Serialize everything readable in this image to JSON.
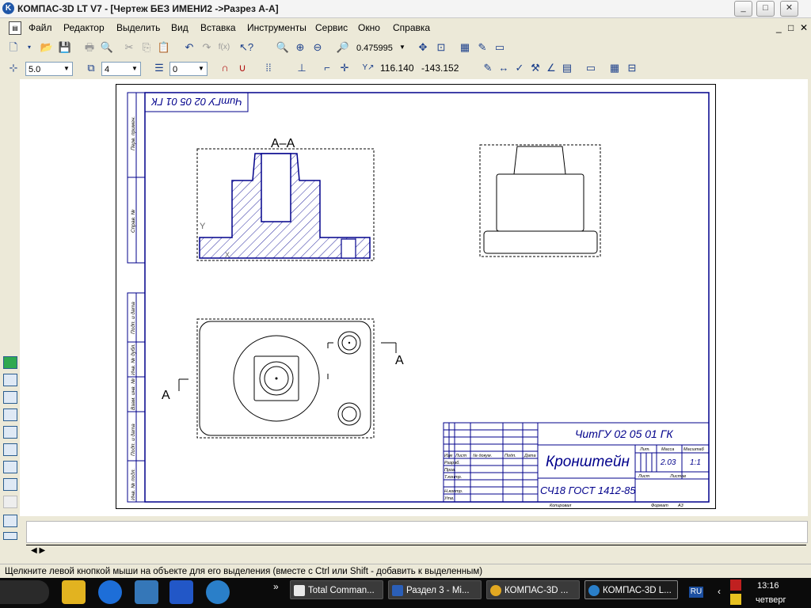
{
  "window": {
    "title": "КОМПАС-3D LT V7 - [Чертеж БЕЗ ИМЕНИ2 ->Разрез А-А]",
    "app_icon": "kompas-icon",
    "buttons": {
      "minimize": "_",
      "maximize": "□",
      "close": "✕"
    }
  },
  "menu": {
    "items": [
      "Файл",
      "Редактор",
      "Выделить",
      "Вид",
      "Вставка",
      "Инструменты",
      "Сервис",
      "Окно",
      "Справка"
    ],
    "mdi_buttons": [
      "_",
      "□",
      "✕"
    ]
  },
  "toolbar1": {
    "zoom_value": "0.475995"
  },
  "toolbar2": {
    "step_value": "5.0",
    "layer_value": "4",
    "style_value": "0",
    "coord_x": "116.140",
    "coord_y": "-143.152"
  },
  "drawing": {
    "section_label": "А–А",
    "cut_label_left": "А",
    "cut_label_right": "А",
    "axis_y": "Y",
    "axis_x": "X",
    "stamp_mirror": "ЧитГУ 02 05 01 ГК",
    "side_labels": [
      "Перв. примен.",
      "Справ. №",
      "Подп. и дата",
      "Инв. № дубл.",
      "Взам. инв. №",
      "Подп. и дата",
      "Инв. № подл."
    ],
    "title_block": {
      "designation": "ЧитГУ 02 05 01 ГК",
      "name": "Кронштейн",
      "material": "СЧ18  ГОСТ 1412-85",
      "headers": [
        "Изм",
        "Лист",
        "№ докум.",
        "Подп.",
        "Дата"
      ],
      "rows": [
        "Разраб.",
        "Пров.",
        "Т.контр.",
        "",
        "Н.контр.",
        "Утв."
      ],
      "lit": "Лит.",
      "mass": "Масса",
      "mass_value": "2.03",
      "scale": "Масштаб",
      "scale_value": "1:1",
      "sheet": "Лист",
      "sheets": "Листов",
      "copied": "Копировал",
      "format": "Формат",
      "format_value": "А3"
    }
  },
  "status": {
    "message": "Щелкните левой кнопкой мыши на объекте для его выделения (вместе с Ctrl или Shift - добавить к выделенным)"
  },
  "taskbar": {
    "tasks": [
      "Total Comman...",
      "Раздел 3 - Mi...",
      "КОМПАС-3D ...",
      "КОМПАС-3D L..."
    ],
    "overflow": "»",
    "lang": "RU",
    "time": "13:16",
    "day": "четверг"
  }
}
